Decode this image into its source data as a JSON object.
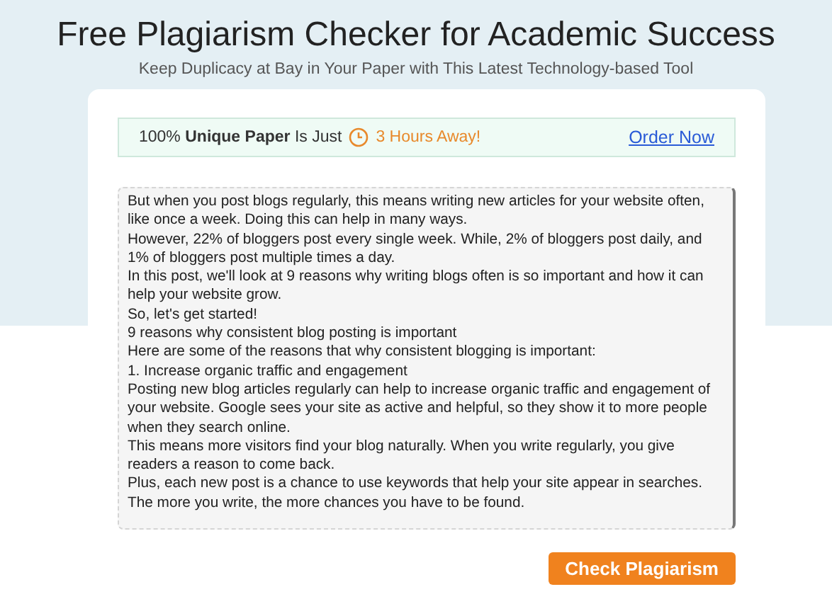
{
  "header": {
    "title": "Free Plagiarism Checker for Academic Success",
    "subtitle": "Keep Duplicacy at Bay in Your Paper with This Latest Technology-based Tool"
  },
  "banner": {
    "text": "100% **Unique Paper** Is Just",
    "highlight": "3 Hours Away!",
    "link": "Order Now"
  },
  "editor": {
    "paragraphs": [
      "But when you post blogs regularly, this means writing new articles for your website often, like once a week. Doing this can help in many ways.",
      "However, 22% of bloggers post every single week. While, 2% of bloggers post daily, and 1% of bloggers post multiple times a day.",
      "In this post, we'll look at 9 reasons why writing blogs often is so important and how it can help your website grow.",
      "So, let's get started!",
      "9 reasons why consistent blog posting is important",
      "Here are some of the reasons that why consistent blogging is important:",
      "1. Increase organic traffic and engagement",
      "Posting new blog articles regularly can help to increase organic traffic and engagement of your website. Google sees your site as active and helpful, so they show it to more people when they search online.",
      "This means more visitors find your blog naturally. When you write regularly, you give readers a reason to come back.",
      "Plus, each new post is a chance to use keywords that help your site appear in searches. The more you write, the more chances you have to be found."
    ]
  },
  "button": "Check Plagiarism"
}
